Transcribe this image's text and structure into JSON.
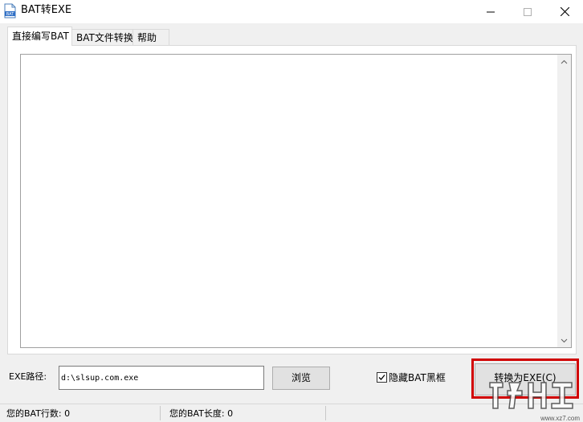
{
  "window": {
    "title": "BAT转EXE",
    "icon": "bat-file-icon",
    "controls": [
      "minimize-icon",
      "maximize-icon",
      "close-icon"
    ]
  },
  "tabs": [
    {
      "label": "直接编写BAT",
      "active": true
    },
    {
      "label": "BAT文件转换",
      "active": false
    },
    {
      "label": "帮助",
      "active": false
    }
  ],
  "editor": {
    "value": ""
  },
  "exe_path": {
    "label": "EXE路径:",
    "value": "d:\\slsup.com.exe"
  },
  "browse_button": "浏览",
  "hide_console": {
    "label": "隐藏BAT黑框",
    "checked": true
  },
  "convert_button": "转换为EXE(C)",
  "status": {
    "line_count": "您的BAT行数: 0",
    "length": "您的BAT长度: 0"
  },
  "colors": {
    "highlight": "#d00000",
    "window_bg": "#f0f0f0"
  },
  "watermark": {
    "site": "www.xz7.com"
  }
}
